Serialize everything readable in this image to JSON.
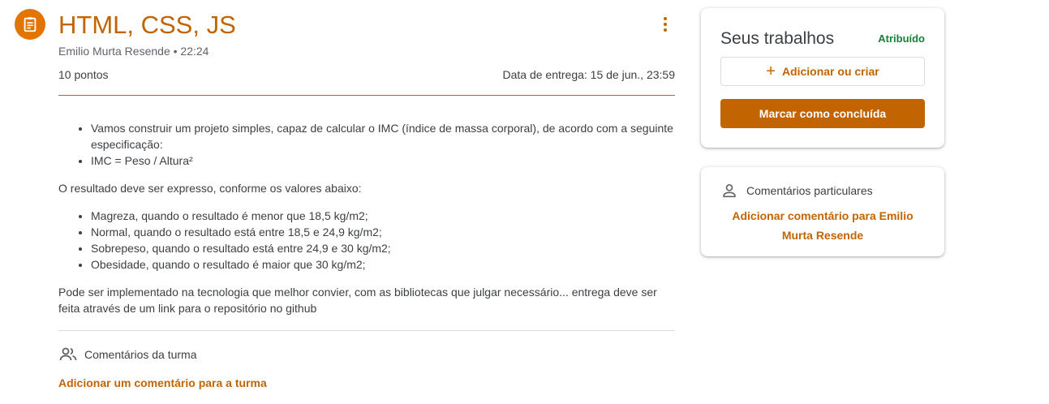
{
  "assignment": {
    "title": "HTML, CSS, JS",
    "author_time": "Emilio Murta Resende • 22:24",
    "points": "10 pontos",
    "due": "Data de entrega: 15 de jun., 23:59",
    "icon": "assignment-icon",
    "more_icon": "more-vert-icon"
  },
  "description": {
    "list1": [
      "Vamos construir um projeto simples, capaz de calcular o IMC (índice de massa corporal), de acordo com a seguinte especificação:",
      "IMC = Peso / Altura²"
    ],
    "para1": "O resultado deve ser expresso, conforme os valores abaixo:",
    "list2": [
      "Magreza, quando o resultado é menor que 18,5 kg/m2;",
      "Normal, quando o resultado está entre 18,5 e 24,9 kg/m2;",
      "Sobrepeso, quando o resultado está entre 24,9 e 30 kg/m2;",
      "Obesidade, quando o resultado é maior que 30 kg/m2;"
    ],
    "para2": "Pode ser implementado na tecnologia que melhor convier, com as bibliotecas que julgar necessário... entrega deve ser feita através de um link para o repositório no github"
  },
  "class_comments": {
    "label": "Comentários da turma",
    "add_link": "Adicionar um comentário para a turma"
  },
  "your_work": {
    "title": "Seus trabalhos",
    "status": "Atribuído",
    "add_button": "Adicionar ou criar",
    "add_icon": "+",
    "done_button": "Marcar como concluída"
  },
  "private_comments": {
    "label": "Comentários particulares",
    "add_link": "Adicionar comentário para Emilio Murta Resende"
  },
  "colors": {
    "accent": "#c26401",
    "icon_bg": "#e37400",
    "status_green": "#188038"
  }
}
